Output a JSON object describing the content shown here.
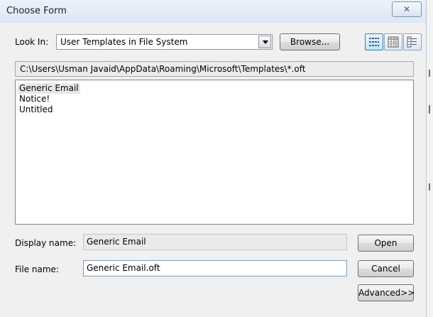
{
  "dialog": {
    "title": "Choose Form",
    "close_glyph": "✕"
  },
  "look_in": {
    "label": "Look In:",
    "value": "User Templates in File System",
    "browse_label": "Browse..."
  },
  "view_buttons": [
    {
      "icon": "list-view-icon"
    },
    {
      "icon": "details-view-icon"
    },
    {
      "icon": "properties-view-icon"
    }
  ],
  "path": "C:\\Users\\Usman Javaid\\AppData\\Roaming\\Microsoft\\Templates\\*.oft",
  "templates": {
    "items": [
      "Generic Email",
      "Notice!",
      "Untitled"
    ],
    "selected_index": 0
  },
  "display_name": {
    "label": "Display name:",
    "value": "Generic Email"
  },
  "file_name": {
    "label": "File name:",
    "value": "Generic Email.oft"
  },
  "buttons": {
    "open": "Open",
    "cancel": "Cancel",
    "advanced": "Advanced>>"
  },
  "colors": {
    "selection": "#e8e8e8",
    "titlebar": "#dce7f5"
  }
}
